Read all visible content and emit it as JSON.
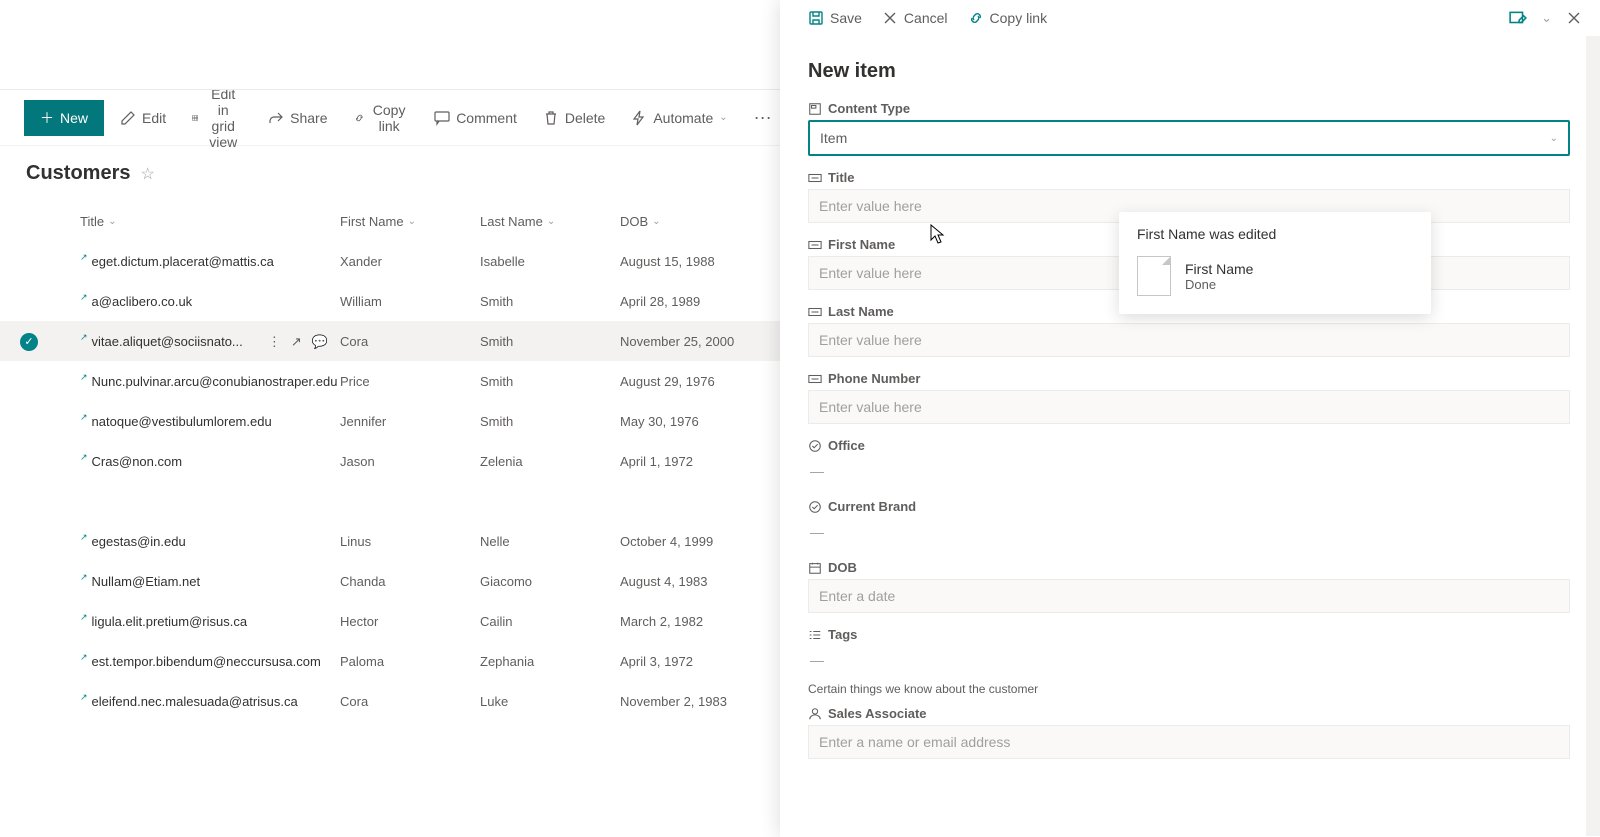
{
  "toolbar": {
    "new": "New",
    "edit": "Edit",
    "editGrid": "Edit in grid view",
    "share": "Share",
    "copyLink": "Copy link",
    "comment": "Comment",
    "delete": "Delete",
    "automate": "Automate"
  },
  "listTitle": "Customers",
  "columns": {
    "title": "Title",
    "firstName": "First Name",
    "lastName": "Last Name",
    "dob": "DOB"
  },
  "rows": [
    {
      "title": "eget.dictum.placerat@mattis.ca",
      "first": "Xander",
      "last": "Isabelle",
      "dob": "August 15, 1988",
      "selected": false
    },
    {
      "title": "a@aclibero.co.uk",
      "first": "William",
      "last": "Smith",
      "dob": "April 28, 1989",
      "selected": false
    },
    {
      "title": "vitae.aliquet@sociisnato...",
      "first": "Cora",
      "last": "Smith",
      "dob": "November 25, 2000",
      "selected": true
    },
    {
      "title": "Nunc.pulvinar.arcu@conubianostraper.edu",
      "first": "Price",
      "last": "Smith",
      "dob": "August 29, 1976",
      "selected": false
    },
    {
      "title": "natoque@vestibulumlorem.edu",
      "first": "Jennifer",
      "last": "Smith",
      "dob": "May 30, 1976",
      "selected": false
    },
    {
      "title": "Cras@non.com",
      "first": "Jason",
      "last": "Zelenia",
      "dob": "April 1, 1972",
      "selected": false
    },
    {
      "title": "egestas@in.edu",
      "first": "Linus",
      "last": "Nelle",
      "dob": "October 4, 1999",
      "selected": false,
      "gapBefore": true
    },
    {
      "title": "Nullam@Etiam.net",
      "first": "Chanda",
      "last": "Giacomo",
      "dob": "August 4, 1983",
      "selected": false
    },
    {
      "title": "ligula.elit.pretium@risus.ca",
      "first": "Hector",
      "last": "Cailin",
      "dob": "March 2, 1982",
      "selected": false
    },
    {
      "title": "est.tempor.bibendum@neccursusa.com",
      "first": "Paloma",
      "last": "Zephania",
      "dob": "April 3, 1972",
      "selected": false
    },
    {
      "title": "eleifend.nec.malesuada@atrisus.ca",
      "first": "Cora",
      "last": "Luke",
      "dob": "November 2, 1983",
      "selected": false
    }
  ],
  "panel": {
    "save": "Save",
    "cancel": "Cancel",
    "copyLink": "Copy link",
    "heading": "New item",
    "contentType": {
      "label": "Content Type",
      "value": "Item"
    },
    "fields": {
      "title": {
        "label": "Title",
        "placeholder": "Enter value here"
      },
      "firstName": {
        "label": "First Name",
        "placeholder": "Enter value here"
      },
      "lastName": {
        "label": "Last Name",
        "placeholder": "Enter value here"
      },
      "phone": {
        "label": "Phone Number",
        "placeholder": "Enter value here"
      },
      "office": {
        "label": "Office",
        "value": "—"
      },
      "brand": {
        "label": "Current Brand",
        "value": "—"
      },
      "dob": {
        "label": "DOB",
        "placeholder": "Enter a date"
      },
      "tags": {
        "label": "Tags",
        "value": "—"
      },
      "tagsHelp": "Certain things we know about the customer",
      "sales": {
        "label": "Sales Associate",
        "placeholder": "Enter a name or email address"
      }
    }
  },
  "popover": {
    "heading": "First Name was edited",
    "name": "First Name",
    "status": "Done"
  }
}
